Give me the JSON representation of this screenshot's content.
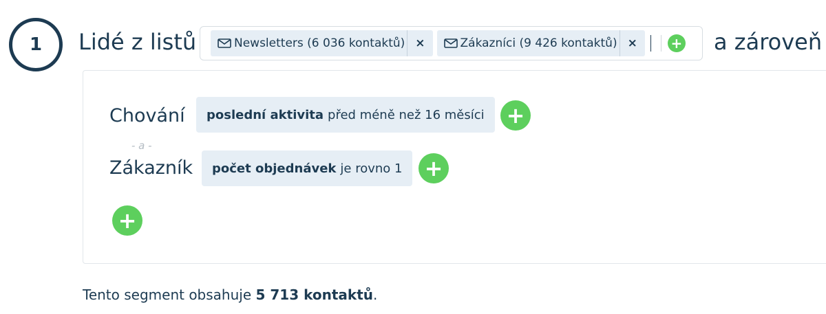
{
  "step": {
    "number": "1"
  },
  "list_filter": {
    "label": "Lidé z listů",
    "tags": [
      {
        "label": "Newsletters (6 036 kontaktů)",
        "remove": "×"
      },
      {
        "label": "Zákazníci (9 426 kontaktů)",
        "remove": "×"
      }
    ],
    "add_icon": "+",
    "and_label": "a zároveň"
  },
  "conditions": {
    "groups": [
      {
        "label": "Chování",
        "chip_bold": "poslední aktivita",
        "chip_text": "před méně než 16 měsíci"
      },
      {
        "label": "Zákazník",
        "chip_bold": "počet objednávek",
        "chip_text": "je rovno 1"
      }
    ],
    "connector": "- a -",
    "add_icon": "+"
  },
  "summary": {
    "prefix": "Tento segment obsahuje ",
    "count": "5 713 kontaktů",
    "suffix": "."
  },
  "colors": {
    "primary_text": "#1d3b52",
    "chip_background": "#e6eef5",
    "add_button": "#5dcf5d"
  }
}
